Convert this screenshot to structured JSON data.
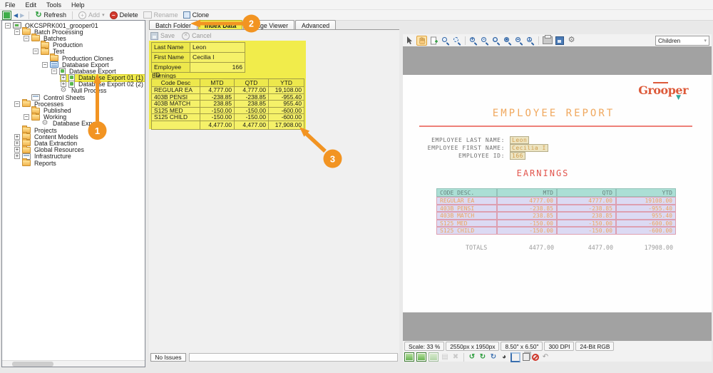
{
  "menu": {
    "items": [
      "File",
      "Edit",
      "Tools",
      "Help"
    ]
  },
  "toolbar": {
    "refresh": "Refresh",
    "add": "Add",
    "delete": "Delete",
    "rename": "Rename",
    "clone": "Clone"
  },
  "tree": {
    "nodes": [
      {
        "label": "OKCSPRK001_grooper01"
      },
      {
        "label": "Batch Processing"
      },
      {
        "label": "Batches"
      },
      {
        "label": "Production"
      },
      {
        "label": "Test"
      },
      {
        "label": "Production Clones"
      },
      {
        "label": "Database Export"
      },
      {
        "label": "Database Export"
      },
      {
        "label": "Database Export 01 (1)"
      },
      {
        "label": "Database Export 02 (2)"
      },
      {
        "label": "Null Process"
      },
      {
        "label": "Control Sheets"
      },
      {
        "label": "Processes"
      },
      {
        "label": "Published"
      },
      {
        "label": "Working"
      },
      {
        "label": "Database Export"
      },
      {
        "label": "Projects"
      },
      {
        "label": "Content Models"
      },
      {
        "label": "Data Extraction"
      },
      {
        "label": "Global Resources"
      },
      {
        "label": "Infrastructure"
      },
      {
        "label": "Reports"
      }
    ]
  },
  "tabs": {
    "batch_folder": "Batch Folder",
    "index_data": "Index Data",
    "image_viewer": "Image Viewer",
    "advanced": "Advanced"
  },
  "form": {
    "save": "Save",
    "cancel": "Cancel",
    "fields": [
      {
        "label": "Last Name",
        "value": "Leon"
      },
      {
        "label": "First Name",
        "value": "Cecilia I"
      },
      {
        "label": "Employee ID",
        "value": "166"
      }
    ],
    "section": "Earnings",
    "table": {
      "headers": [
        "Code Desc",
        "MTD",
        "QTD",
        "YTD"
      ],
      "rows": [
        [
          "REGULAR EA",
          "4,777.00",
          "4,777.00",
          "19,108.00"
        ],
        [
          "403B PENSI",
          "-238.85",
          "-238.85",
          "-955.40"
        ],
        [
          "403B MATCH",
          "238.85",
          "238.85",
          "955.40"
        ],
        [
          "S125 MED",
          "-150.00",
          "-150.00",
          "-600.00"
        ],
        [
          "S125 CHILD",
          "-150.00",
          "-150.00",
          "-600.00"
        ]
      ],
      "totals": [
        "4,477.00",
        "4,477.00",
        "17,908.00"
      ]
    }
  },
  "viewer": {
    "mode_select": "Children",
    "chips": [
      "Scale: 33 %",
      "2550px x 1950px",
      "8.50\" x 6.50\"",
      "300 DPI",
      "24-Bit RGB"
    ]
  },
  "document": {
    "logo": "Grooper",
    "title": "EMPLOYEE REPORT",
    "fields": [
      {
        "label": "EMPLOYEE LAST NAME:",
        "value": "Leon"
      },
      {
        "label": "EMPLOYEE FIRST NAME:",
        "value": "Cecilia I"
      },
      {
        "label": "EMPLOYEE ID:",
        "value": "166"
      }
    ],
    "section": "EARNINGS",
    "table": {
      "headers": [
        "CODE DESC.",
        "MTD",
        "QTD",
        "YTD"
      ],
      "rows": [
        [
          "REGULAR EA",
          "4777.00",
          "4777.00",
          "19108.00"
        ],
        [
          "403B PENSI",
          "-238.85",
          "-238.85",
          "-955.40"
        ],
        [
          "403B MATCH",
          "238.85",
          "238.85",
          "955.40"
        ],
        [
          "S125 MED",
          "-150.00",
          "-150.00",
          "-600.00"
        ],
        [
          "S125 CHILD",
          "-150.00",
          "-150.00",
          "-600.00"
        ]
      ],
      "totals_label": "TOTALS",
      "totals": [
        "4477.00",
        "4477.00",
        "17908.00"
      ]
    }
  },
  "callouts": {
    "c1": "1",
    "c2": "2",
    "c3": "3"
  },
  "statusbar": {
    "no_issues": "No Issues"
  },
  "colors": {
    "accent_orange": "#f29422",
    "highlight_yellow": "#f1ec4b",
    "doc_teal": "#abdfd5",
    "doc_lavender": "#dcdaf3",
    "doc_pink": "#dd9fb0",
    "logo_red": "#dd5a3a"
  }
}
